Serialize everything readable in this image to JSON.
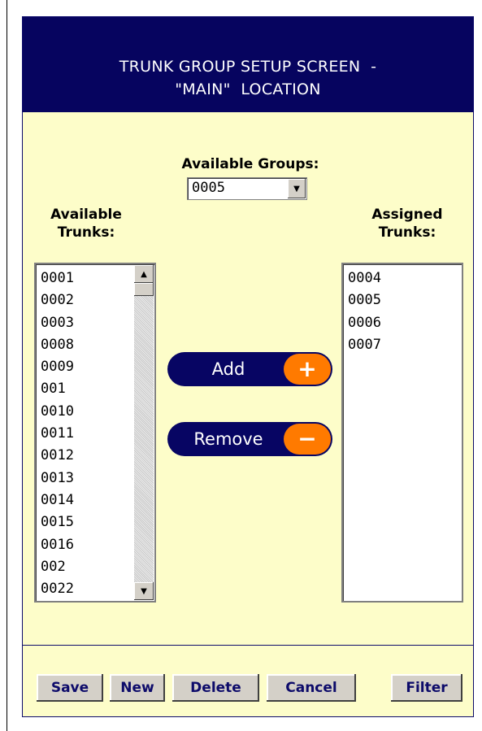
{
  "header": {
    "line1": "TRUNK GROUP SETUP SCREEN  -",
    "line2": "\"MAIN\"  LOCATION"
  },
  "groups": {
    "label": "Available Groups:",
    "selected": "0005"
  },
  "available": {
    "label_line1": "Available",
    "label_line2": "Trunks:",
    "items": [
      "0001",
      "0002",
      "0003",
      "0008",
      "0009",
      "001",
      "0010",
      "0011",
      "0012",
      "0013",
      "0014",
      "0015",
      "0016",
      "002",
      "0022"
    ]
  },
  "assigned": {
    "label_line1": "Assigned",
    "label_line2": "Trunks:",
    "items": [
      "0004",
      "0005",
      "0006",
      "0007"
    ]
  },
  "actions": {
    "add_label": "Add",
    "add_symbol": "+",
    "remove_label": "Remove",
    "remove_symbol": "−"
  },
  "footer": {
    "save": "Save",
    "new": "New",
    "delete": "Delete",
    "cancel": "Cancel",
    "filter": "Filter"
  },
  "icons": {
    "scroll_up": "scroll-up-icon",
    "scroll_down": "scroll-down-icon",
    "dropdown": "chevron-down-icon"
  },
  "colors": {
    "header_bg": "#06045f",
    "panel_bg": "#fdfdc9",
    "accent": "#ff7a00"
  }
}
